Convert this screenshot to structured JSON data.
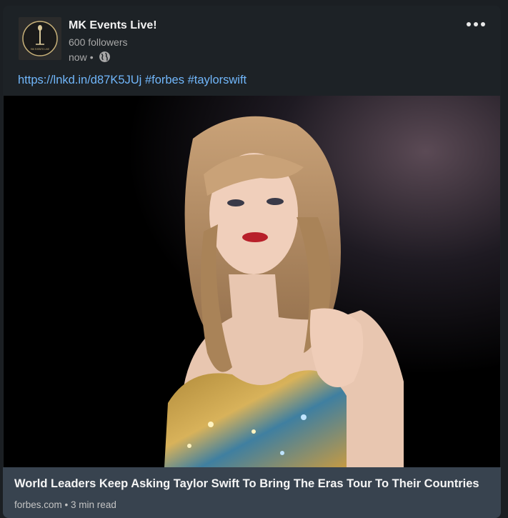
{
  "author": {
    "name": "MK Events Live!",
    "followers": "600 followers",
    "time": "now",
    "separator": "•",
    "visibility_icon": "globe-icon",
    "avatar_text": "MK EVENTS LIVE"
  },
  "post": {
    "link": "https://lnkd.in/d87K5JUj",
    "hashtags": [
      "#forbes",
      "#taylorswift"
    ]
  },
  "media": {
    "description_icon": "photo-image"
  },
  "link_preview": {
    "title": "World Leaders Keep Asking Taylor Swift To Bring The Eras Tour To Their Countries",
    "source": "forbes.com",
    "separator": "•",
    "read_time": "3 min read"
  },
  "colors": {
    "background": "#1b1f23",
    "card": "#1d2226",
    "link": "#71b7fb",
    "footer": "#38434f"
  }
}
